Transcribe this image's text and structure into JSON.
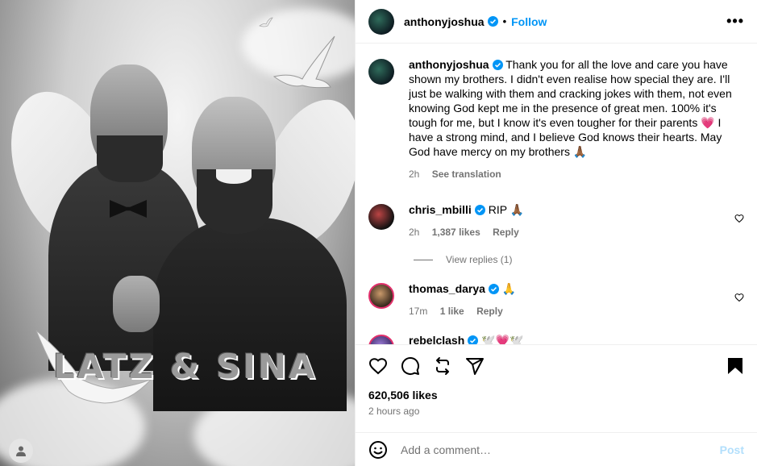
{
  "media": {
    "overlay_title": "LATZ & SINA"
  },
  "header": {
    "username": "anthonyjoshua",
    "separator": "•",
    "follow_label": "Follow",
    "more_label": "•••"
  },
  "caption": {
    "username": "anthonyjoshua",
    "text": "Thank you for all the love and care you have shown my brothers. I didn't even realise how special they are. I'll just be walking with them and cracking jokes with them, not even knowing God kept me in the presence of great men. 100% it's tough for me, but I know it's even tougher for their parents 💗 I have a strong mind, and I believe God knows their hearts. May God have mercy on my brothers 🙏🏾",
    "time": "2h",
    "see_translation": "See translation"
  },
  "comments": [
    {
      "username": "chris_mbilli",
      "text": "RIP 🙏🏾",
      "time": "2h",
      "likes": "1,387 likes",
      "reply": "Reply"
    },
    {
      "username": "thomas_darya",
      "text": "🙏",
      "time": "17m",
      "likes": "1 like",
      "reply": "Reply"
    },
    {
      "username": "rebelclash",
      "text": "🕊️💗🕊️"
    }
  ],
  "view_replies": "View replies (1)",
  "post_stats": {
    "likes": "620,506 likes",
    "time": "2 hours ago"
  },
  "add_comment": {
    "placeholder": "Add a comment…",
    "post_label": "Post"
  },
  "colors": {
    "accent": "#0095f6",
    "post_disabled": "#b2dffc",
    "meta": "#737373",
    "heart": "#ff3040"
  },
  "icons": [
    "verified-badge-icon",
    "more-options-icon",
    "heart-icon",
    "comment-icon",
    "share-icon",
    "send-icon",
    "bookmark-icon",
    "emoji-icon",
    "user-icon"
  ]
}
